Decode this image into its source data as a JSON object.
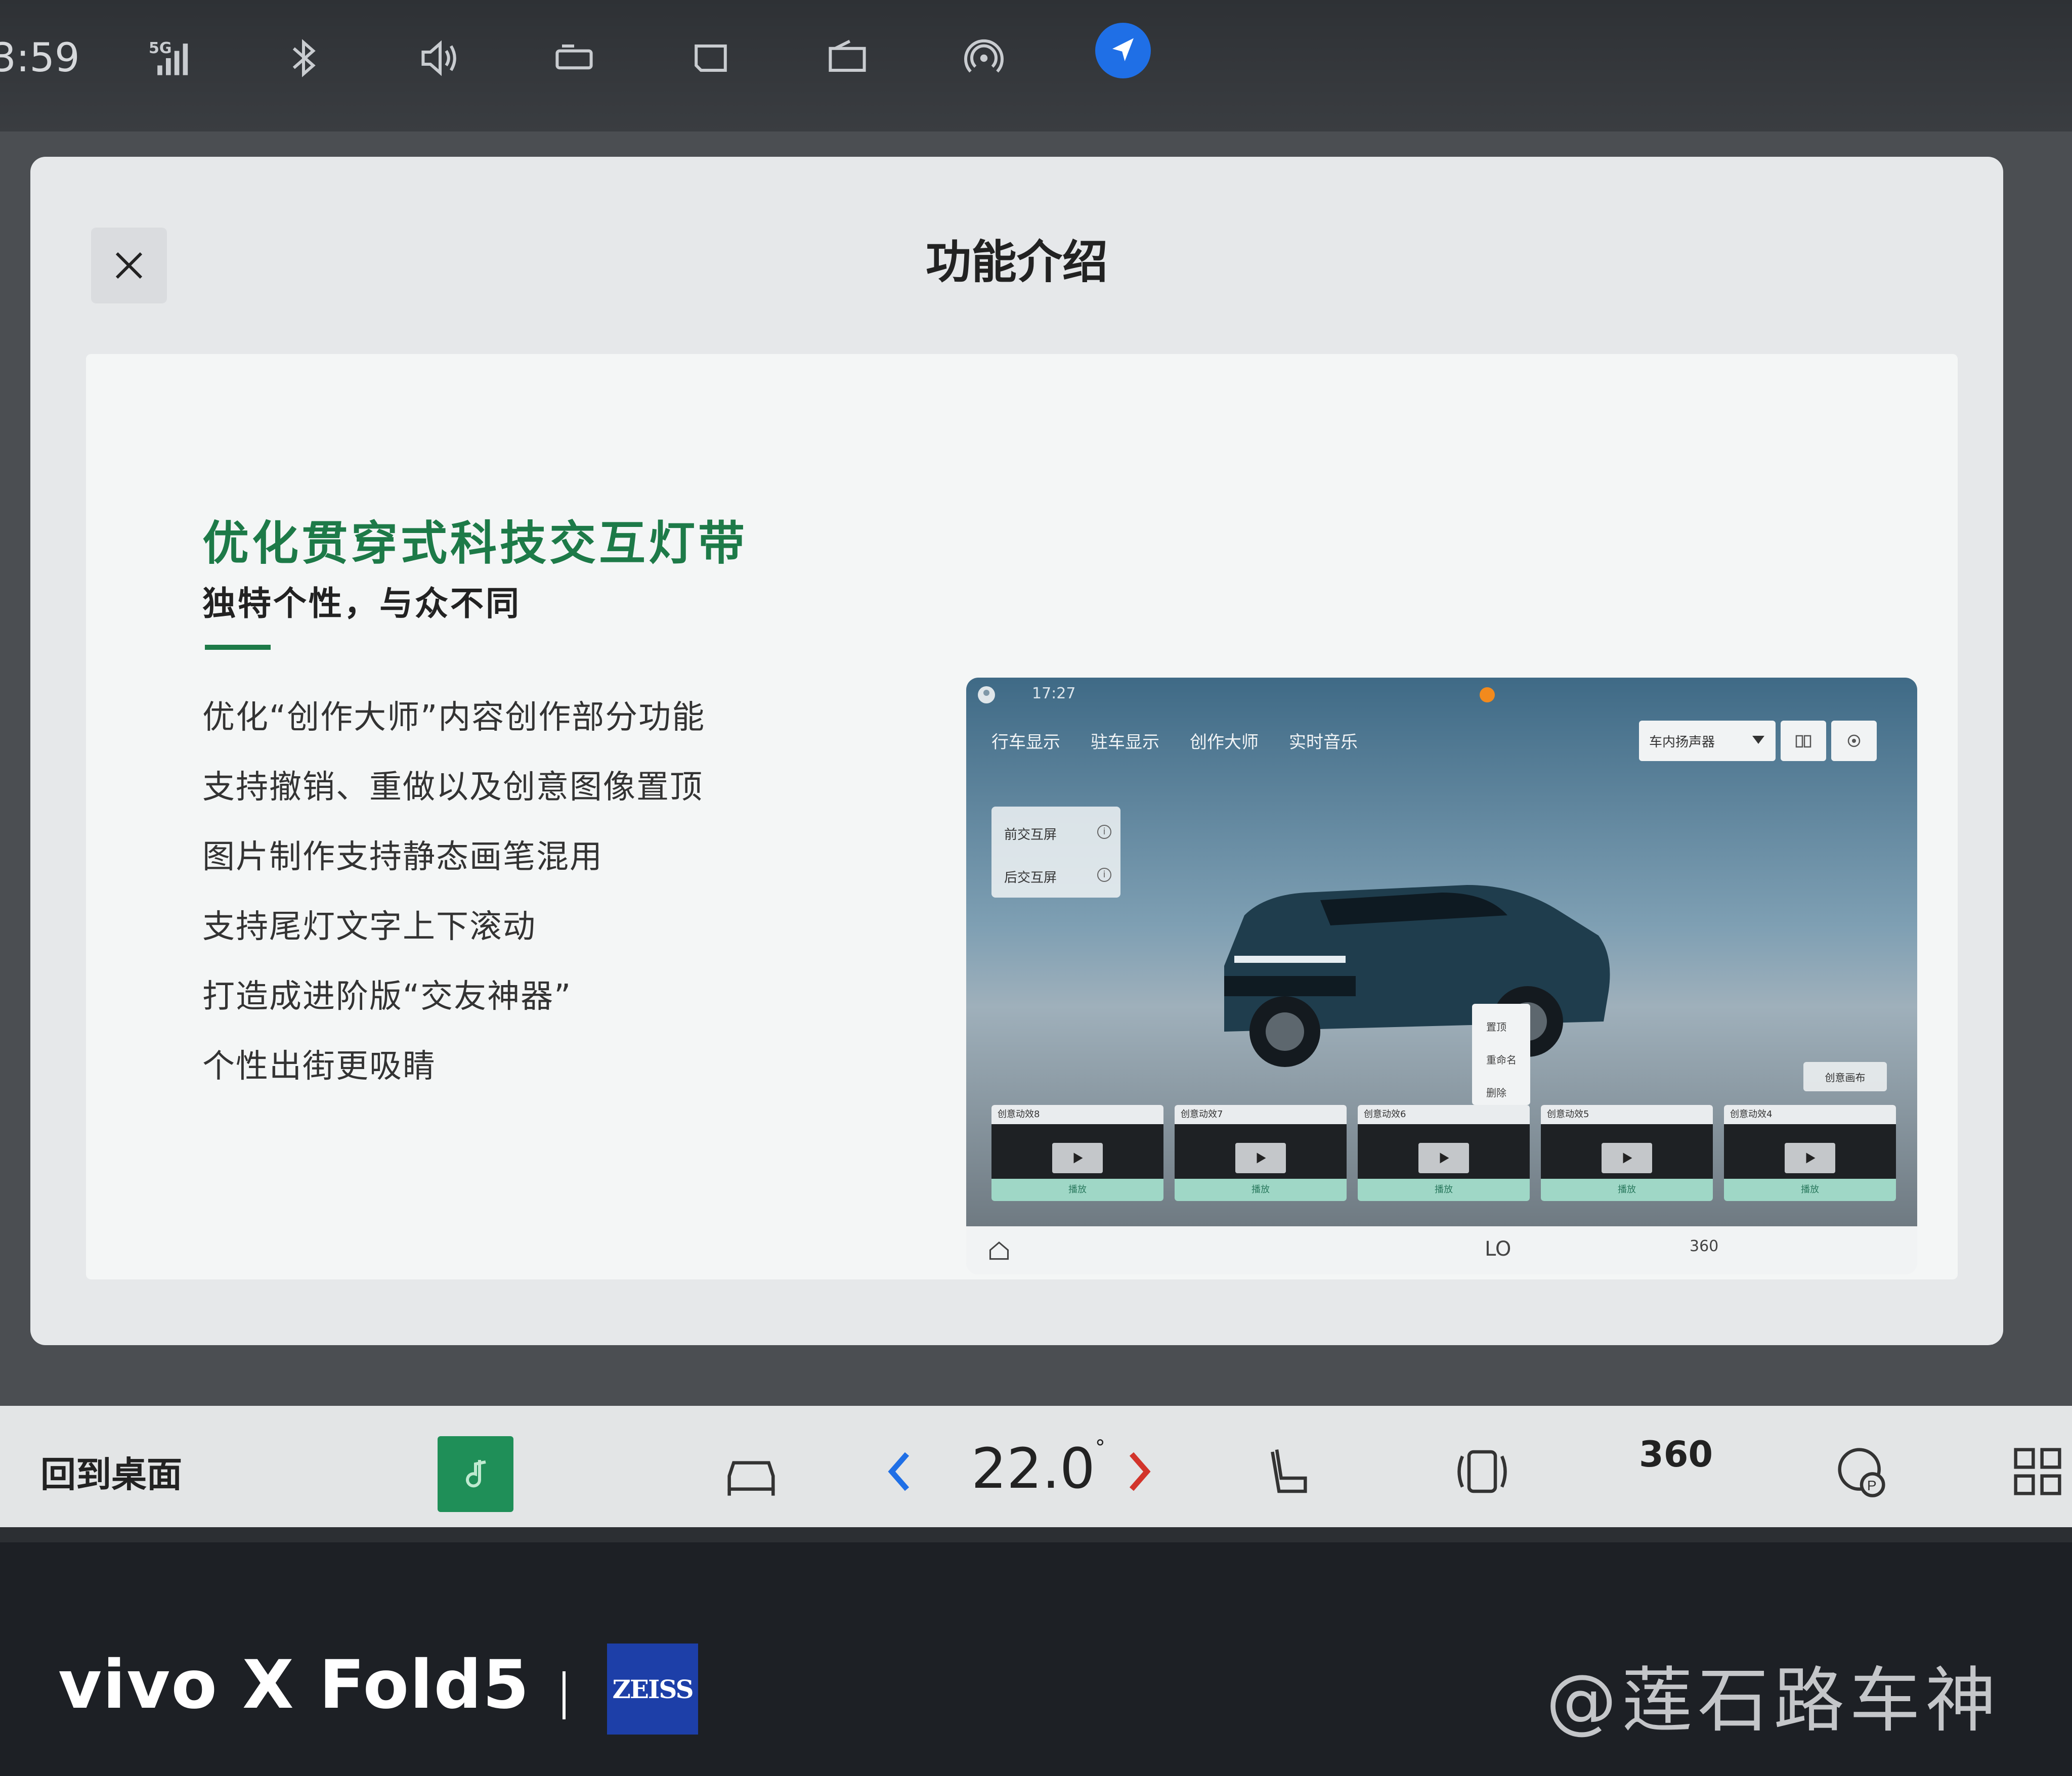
{
  "status_bar": {
    "time": "3:59",
    "signal_label": "5G",
    "icons": [
      "signal-icon",
      "bluetooth-icon",
      "volume-icon",
      "seat-heat-icon",
      "rear-defrost-icon",
      "window-icon",
      "hotspot-icon",
      "navigation-icon"
    ],
    "accent_color": "#1f6fe6"
  },
  "dialog": {
    "title": "功能介绍",
    "close_icon": "close-icon",
    "feature": {
      "title": "优化贯穿式科技交互灯带",
      "subtitle": "独特个性，与众不同",
      "title_color": "#1d7a48",
      "items": [
        "优化“创作大师”内容创作部分功能",
        "支持撤销、重做以及创意图像置顶",
        "图片制作支持静态画笔混用",
        "支持尾灯文字上下滚动",
        "打造成进阶版“交友神器”",
        "个性出街更吸睛"
      ]
    },
    "preview": {
      "time": "17:27",
      "tabs": [
        "行车显示",
        "驻车显示",
        "创作大师",
        "实时音乐"
      ],
      "speaker_select": "车内扬声器",
      "side_items": [
        "前交互屏",
        "后交互屏"
      ],
      "context_menu": [
        "置顶",
        "重命名",
        "删除"
      ],
      "create_button": "创意画布",
      "cards": [
        {
          "title": "创意动效8",
          "action": "播放"
        },
        {
          "title": "创意动效7",
          "action": "播放"
        },
        {
          "title": "创意动效6",
          "action": "播放"
        },
        {
          "title": "创意动效5",
          "action": "播放"
        },
        {
          "title": "创意动效4",
          "action": "播放"
        }
      ],
      "dock_temp": "LO",
      "dock_360": "360"
    }
  },
  "dock": {
    "home_label": "回到桌面",
    "temperature": "22.0",
    "degree": "°",
    "label_360": "360",
    "music_color": "#1f8f58",
    "accent_left": "#1f6fe6",
    "accent_right": "#d2342b"
  },
  "watermark": {
    "brand": "vivo X Fold5",
    "zeiss": "ZEISS",
    "author": "@莲石路车神"
  }
}
